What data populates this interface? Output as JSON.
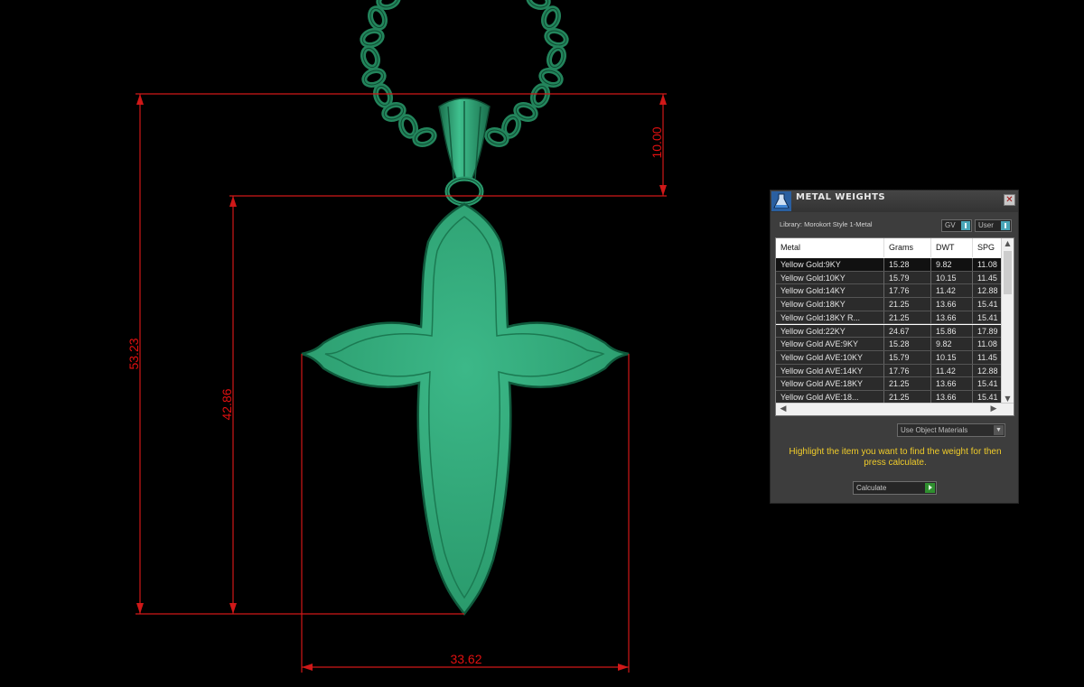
{
  "dimensions": {
    "total_height": "53.23",
    "body_height": "42.86",
    "bail_height": "10.00",
    "width": "33.62"
  },
  "panel": {
    "title": "METAL WEIGHTS",
    "close_glyph": "✕",
    "library_label": "Library: Morokort Style 1-Metal",
    "toggle_gv": "GV",
    "toggle_user": "User",
    "columns": [
      "Metal",
      "Grams",
      "DWT",
      "SPG"
    ],
    "rows": [
      [
        "Yellow Gold:9KY",
        "15.28",
        "9.82",
        "11.08"
      ],
      [
        "Yellow Gold:10KY",
        "15.79",
        "10.15",
        "11.45"
      ],
      [
        "Yellow Gold:14KY",
        "17.76",
        "11.42",
        "12.88"
      ],
      [
        "Yellow Gold:18KY",
        "21.25",
        "13.66",
        "15.41"
      ],
      [
        "Yellow Gold:18KY R...",
        "21.25",
        "13.66",
        "15.41"
      ],
      [
        "Yellow Gold:22KY",
        "24.67",
        "15.86",
        "17.89"
      ],
      [
        "Yellow Gold AVE:9KY",
        "15.28",
        "9.82",
        "11.08"
      ],
      [
        "Yellow Gold AVE:10KY",
        "15.79",
        "10.15",
        "11.45"
      ],
      [
        "Yellow Gold AVE:14KY",
        "17.76",
        "11.42",
        "12.88"
      ],
      [
        "Yellow Gold AVE:18KY",
        "21.25",
        "13.66",
        "15.41"
      ],
      [
        "Yellow Gold AVE:18...",
        "21.25",
        "13.66",
        "15.41"
      ]
    ],
    "selected_row": 0,
    "material_select": "Use Object Materials",
    "hint": "Highlight the item you want to find the weight for then press calculate.",
    "calculate_label": "Calculate"
  },
  "colors": {
    "dimension_red": "#d01818",
    "model_green": "#2fa577",
    "hint_yellow": "#f0cc2a"
  }
}
